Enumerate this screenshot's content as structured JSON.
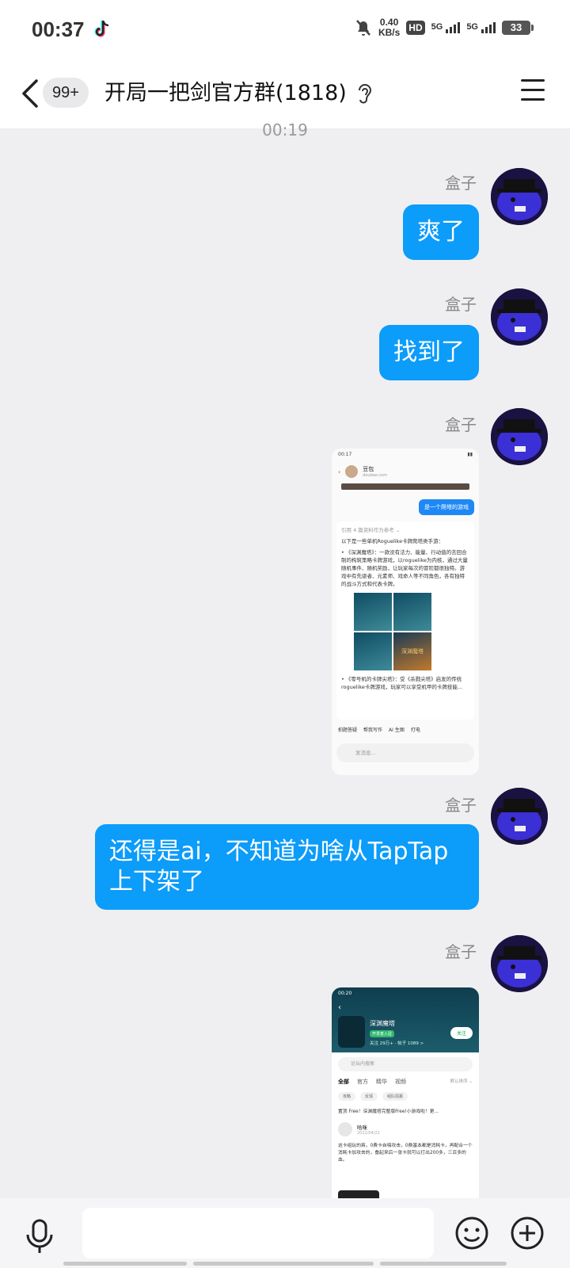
{
  "status_bar": {
    "time": "00:37",
    "net_speed_value": "0.40",
    "net_speed_unit": "KB/s",
    "hd_label": "HD",
    "sim1_label": "5G",
    "sim2_label": "5G",
    "battery": "33"
  },
  "header": {
    "unread_count": "99+",
    "title": "开局一把剑官方群(1818)"
  },
  "messages": {
    "time_stamp": "00:19",
    "sender_name": "盒子",
    "msg1_text": "爽了",
    "msg2_text": "找到了",
    "msg4_text": "还得是ai，不知道为啥从TapTap上下架了"
  },
  "screenshot1": {
    "status_time": "00:17",
    "bot_name": "豆包",
    "bot_domain": "doubao.com",
    "question": "是一个爬塔的游戏",
    "ref_text": "引用 4 篇资料作为参考 ⌄",
    "intro": "以下是一些单机Roguelike卡牌爬塔类手游：",
    "item1": "• 《深渊魔塔》：一款没有法力、能量、行动值的去回合制的构筑策略卡牌游戏，以roguelike为内核，通过大量随机事件、随机奖励，让玩家每次的冒险都很独特。游戏中有先驱者、元素师、戏命人等不同角色，各有独特的战斗方式和代表卡牌。",
    "image_caption": "深渊魔塔",
    "item2": "• 《零号机的卡牌尖塔》：受《杀戮尖塔》启发的传统roguelike卡牌游戏，玩家可以享受机甲的卡牌技能...",
    "tool1": "拍题答疑",
    "tool2": "帮我写作",
    "tool3": "AI 生图",
    "tool4": "打电",
    "input_placeholder": "发消息..."
  },
  "screenshot2": {
    "status_time": "00:20",
    "game_name": "深渊魔塔",
    "tag": "开发者入驻",
    "followers": "关注 29万+ · 帖子 1089 >",
    "follow_btn": "关注",
    "search_placeholder": "论坛内搜索",
    "tabs": [
      "全部",
      "官方",
      "精华",
      "视频"
    ],
    "sort": "默认排序 ⌄",
    "chips": [
      "攻略",
      "反馈",
      "组队招募"
    ],
    "notice": "置顶  Free！深渊魔塔完整版Free!小游戏啦！更...",
    "post_user": "哈咪",
    "post_date": "2022/04/22",
    "post_text": "这卡组玩的爽，0费卡自嗨攻击，0费基本都是消耗卡，再配合一个消耗卡加攻击的，叠起来后一张卡就可以打出200多，三百多的血。"
  },
  "input": {
    "placeholder": ""
  }
}
